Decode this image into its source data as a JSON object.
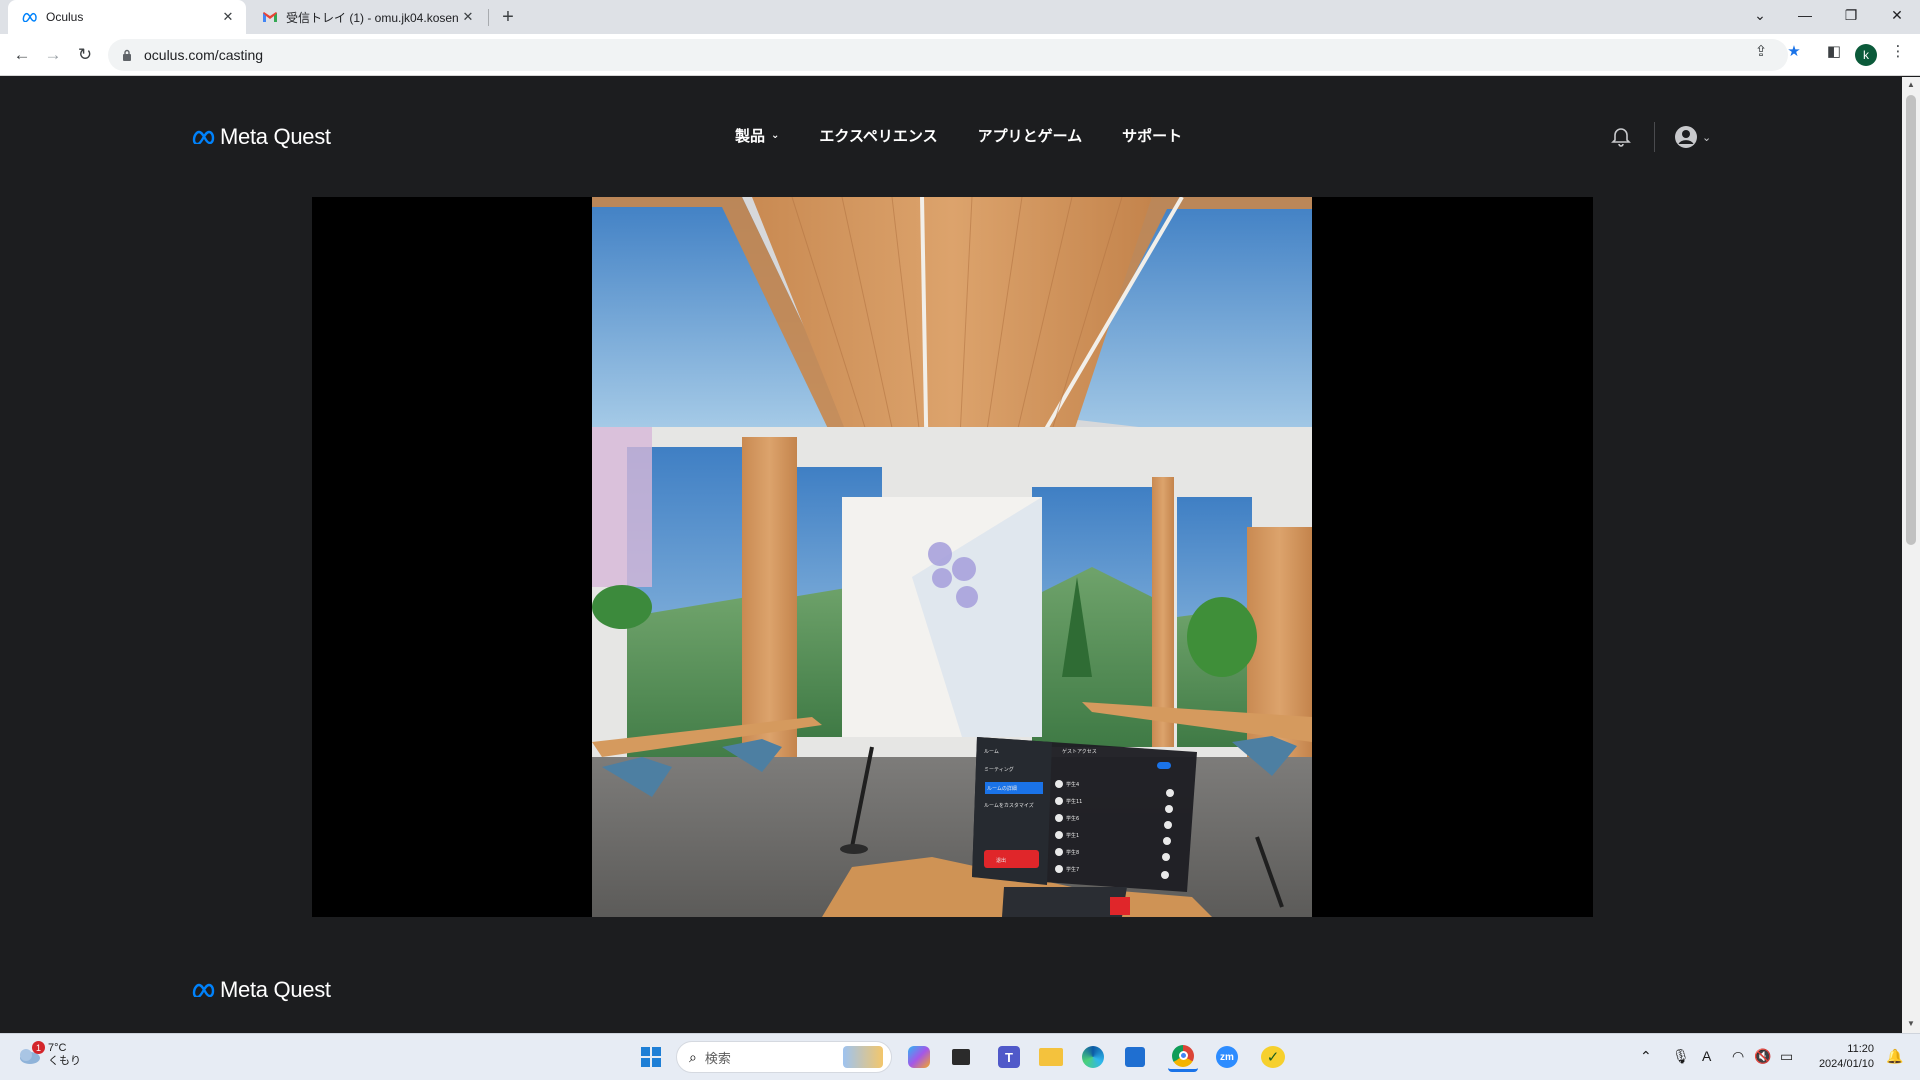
{
  "browser": {
    "tabs": [
      {
        "title": "Oculus",
        "active": true
      },
      {
        "title": "受信トレイ (1) - omu.jk04.kosen@",
        "active": false
      }
    ],
    "url": "oculus.com/casting",
    "profile_initial": "k"
  },
  "site": {
    "brand": "Meta Quest",
    "nav": [
      {
        "label": "製品",
        "has_dropdown": true
      },
      {
        "label": "エクスペリエンス",
        "has_dropdown": false
      },
      {
        "label": "アプリとゲーム",
        "has_dropdown": false
      },
      {
        "label": "サポート",
        "has_dropdown": false
      }
    ],
    "footer_brand": "Meta Quest"
  },
  "vr_panel": {
    "menu_title": "ルーム",
    "menu_items": [
      "ミーティング",
      "ルームの詳細",
      "ルームをカスタマイズ"
    ],
    "leave_label": "退出",
    "header": "ゲストアクセス",
    "participants": [
      "学生4",
      "学生11",
      "学生6",
      "学生1",
      "学生8",
      "学生7"
    ]
  },
  "taskbar": {
    "weather_temp": "7°C",
    "weather_desc": "くもり",
    "weather_badge": "1",
    "search_placeholder": "検索",
    "time": "11:20",
    "date": "2024/01/10"
  },
  "colors": {
    "page_bg": "#1c1d1f",
    "accent_blue": "#1a73e8",
    "meta_blue": "#0082fb"
  }
}
